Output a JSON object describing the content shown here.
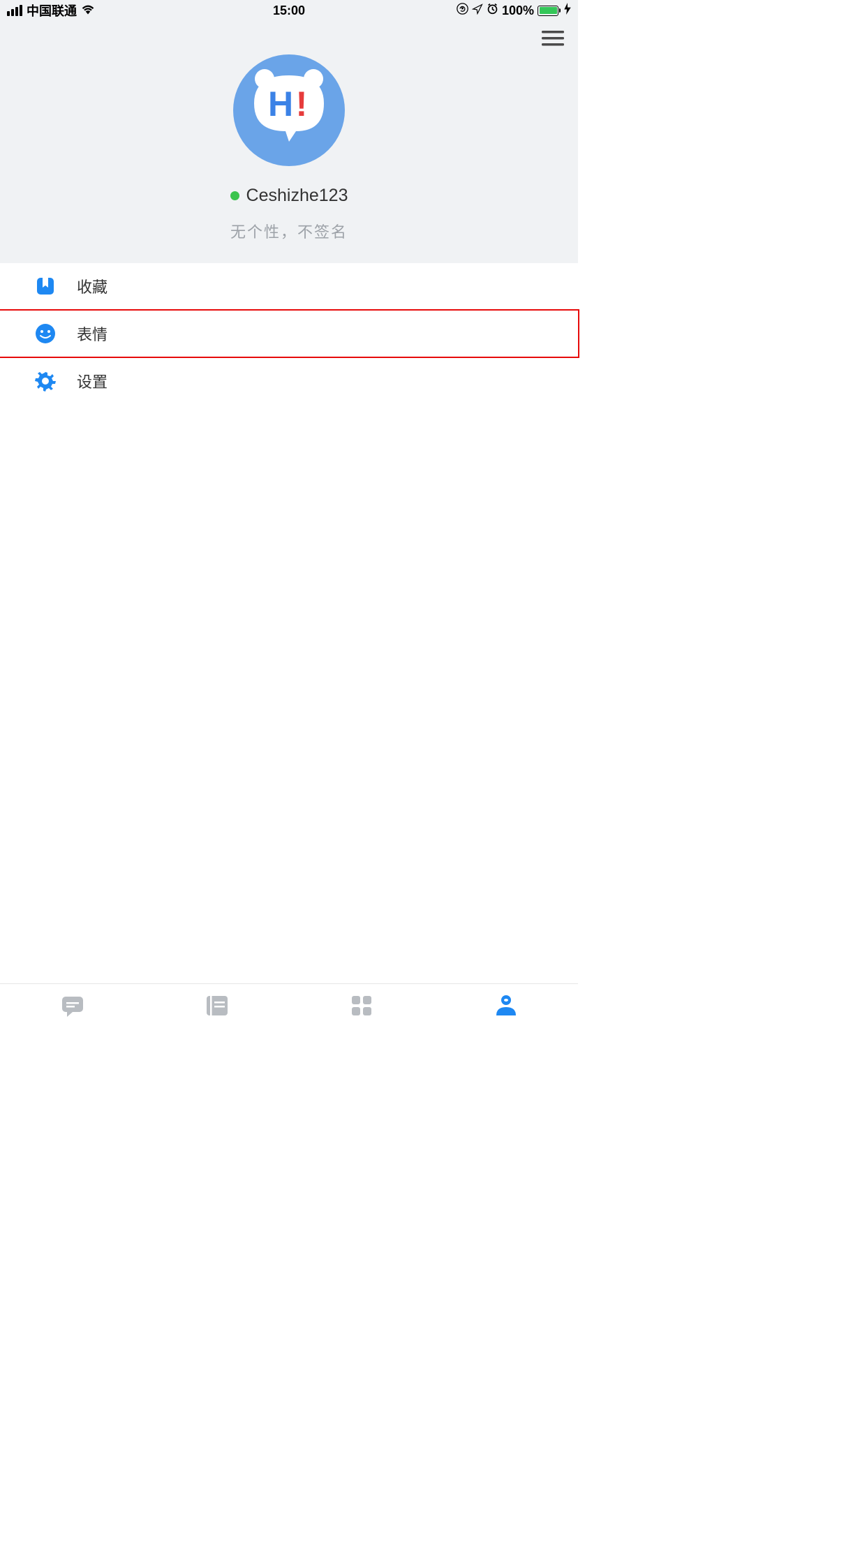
{
  "status_bar": {
    "carrier": "中国联通",
    "time": "15:00",
    "battery": "100%"
  },
  "profile": {
    "username": "Ceshizhe123",
    "signature": "无个性，不签名",
    "avatar_h": "H",
    "avatar_excl": "!"
  },
  "menu": {
    "items": [
      {
        "label": "收藏",
        "icon": "bookmark"
      },
      {
        "label": "表情",
        "icon": "smiley"
      },
      {
        "label": "设置",
        "icon": "gear"
      }
    ]
  },
  "tabs": [
    {
      "name": "chat",
      "active": false
    },
    {
      "name": "feed",
      "active": false
    },
    {
      "name": "grid",
      "active": false
    },
    {
      "name": "profile",
      "active": true
    }
  ]
}
